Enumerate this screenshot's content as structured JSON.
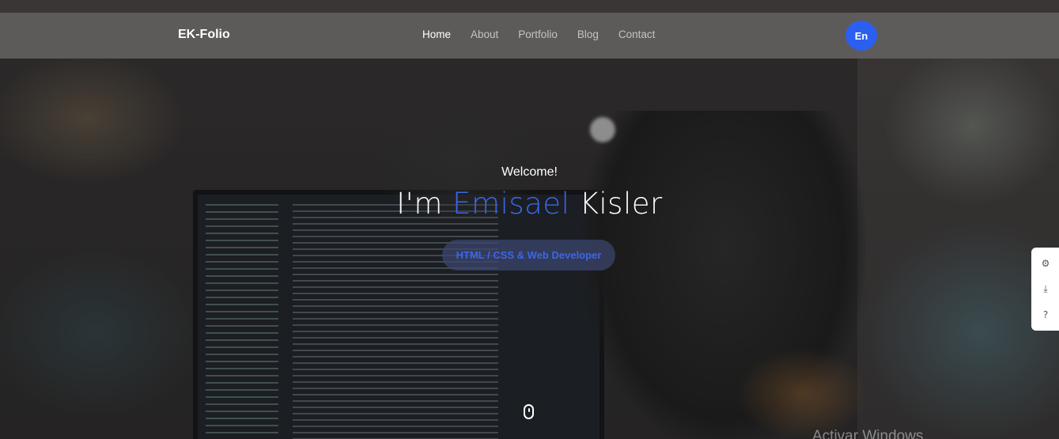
{
  "navbar": {
    "brand": "EK-Folio",
    "links": [
      {
        "label": "Home",
        "active": true
      },
      {
        "label": "About",
        "active": false
      },
      {
        "label": "Portfolio",
        "active": false
      },
      {
        "label": "Blog",
        "active": false
      },
      {
        "label": "Contact",
        "active": false
      }
    ],
    "language_button": "En"
  },
  "hero": {
    "welcome": "Welcome!",
    "title_prefix": "I'm",
    "title_first_name": "Emisael",
    "title_last_name": "Kisler",
    "role": "HTML / CSS & Web Developer",
    "scroll_icon": "mouse-scroll-icon"
  },
  "side_toolbar": {
    "items": [
      {
        "icon": "gear-icon",
        "glyph": "⚙"
      },
      {
        "icon": "download-icon",
        "glyph": "⤓"
      },
      {
        "icon": "help-icon",
        "glyph": "?"
      }
    ]
  },
  "watermark": "Activar Windows",
  "colors": {
    "accent": "#3c66e8",
    "language_button": "#2b5ff0",
    "navbar": "#625f5d"
  }
}
